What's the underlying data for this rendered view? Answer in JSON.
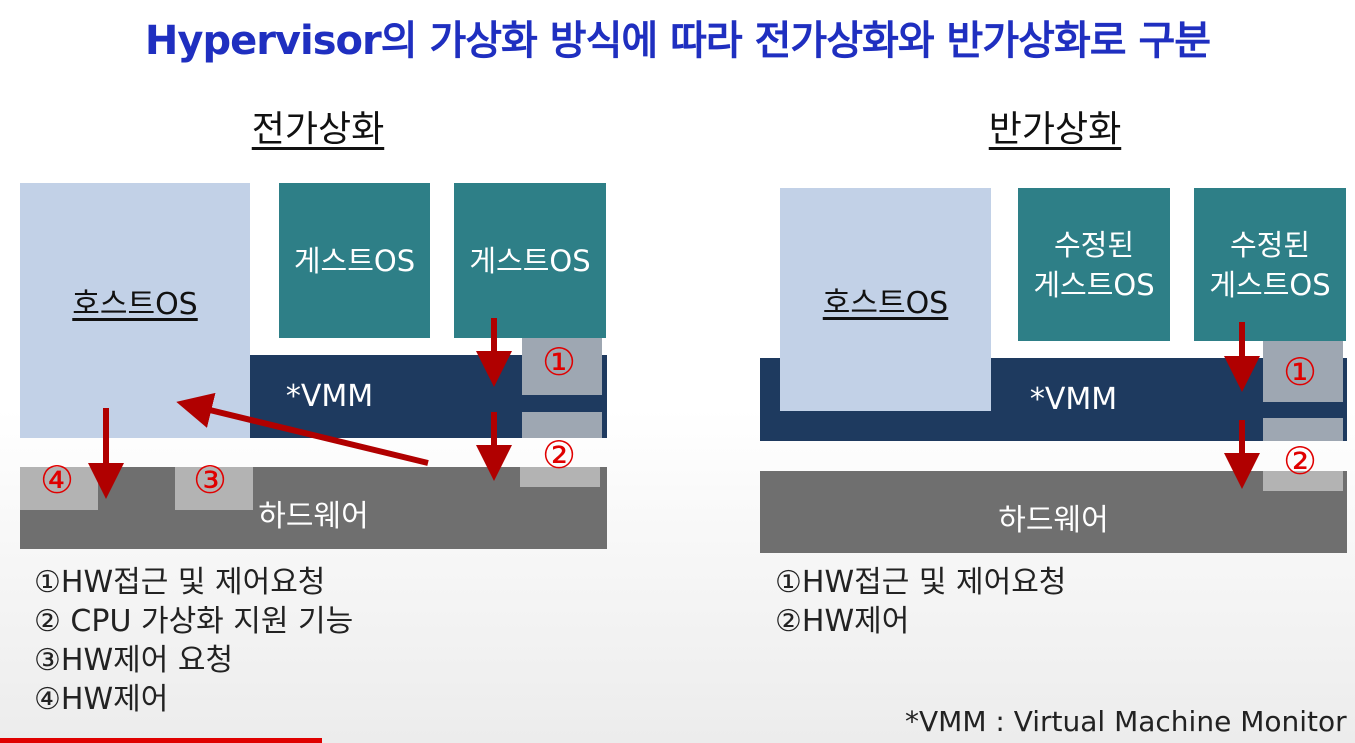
{
  "title": "Hypervisor의 가상화 방식에 따라 전가상화와 반가상화로 구분",
  "full": {
    "heading": "전가상화",
    "host": "호스트OS",
    "guest1": "게스트OS",
    "guest2": "게스트OS",
    "vmm": "*VMM",
    "hardware": "하드웨어",
    "markers": [
      "①",
      "②",
      "③",
      "④"
    ],
    "legend": [
      "①HW접근 및 제어요청",
      "② CPU 가상화 지원 기능",
      "③HW제어 요청",
      "④HW제어"
    ]
  },
  "para": {
    "heading": "반가상화",
    "host": "호스트OS",
    "guest1_l1": "수정된",
    "guest1_l2": "게스트OS",
    "guest2_l1": "수정된",
    "guest2_l2": "게스트OS",
    "vmm": "*VMM",
    "hardware": "하드웨어",
    "markers": [
      "①",
      "②"
    ],
    "legend": [
      "①HW접근 및 제어요청",
      "②HW제어"
    ]
  },
  "footnote": "*VMM : Virtual Machine Monitor",
  "colors": {
    "title": "#1f2fc0",
    "host": "#c2d1e7",
    "guest": "#2e7f87",
    "vmm": "#1e3a5f",
    "hardware": "#6f6f6f",
    "arrow": "#b00000",
    "marker": "#e00000"
  }
}
